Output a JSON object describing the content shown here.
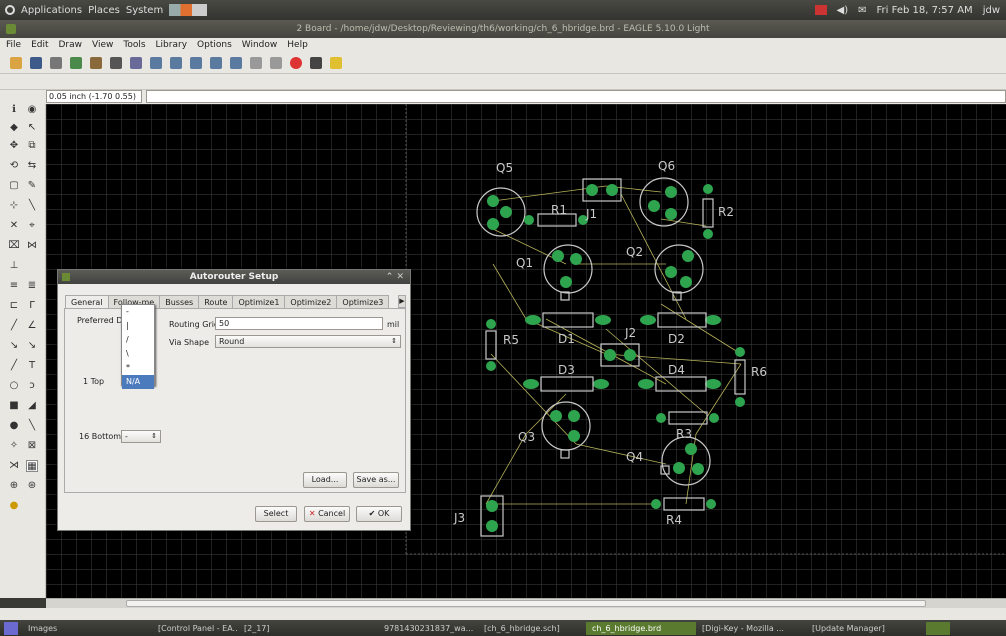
{
  "topbar": {
    "menus": [
      "Applications",
      "Places",
      "System"
    ],
    "datetime": "Fri Feb 18, 7:57 AM",
    "user": "jdw"
  },
  "window_title": "2 Board - /home/jdw/Desktop/Reviewing/th6/working/ch_6_hbridge.brd - EAGLE 5.10.0 Light",
  "menubar": [
    "File",
    "Edit",
    "Draw",
    "View",
    "Tools",
    "Library",
    "Options",
    "Window",
    "Help"
  ],
  "coord_readout": "0.05 inch (-1.70 0.55)",
  "canvas_labels": [
    "Q5",
    "Q6",
    "R1",
    "J1",
    "R2",
    "Q1",
    "Q2",
    "R5",
    "D1",
    "J2",
    "D2",
    "R6",
    "D3",
    "D4",
    "R3",
    "Q3",
    "Q4",
    "J3",
    "R4"
  ],
  "dialog": {
    "title": "Autorouter Setup",
    "tabs": [
      "General",
      "Follow-me",
      "Busses",
      "Route",
      "Optimize1",
      "Optimize2",
      "Optimize3"
    ],
    "preferred_label": "Preferred Dir",
    "layer_top": "1 Top",
    "layer_bottom": "16 Bottom",
    "bottom_value": "-",
    "routing_grid_label": "Routing Grid",
    "routing_grid_value": "50",
    "routing_grid_unit": "mil",
    "via_shape_label": "Via Shape",
    "via_shape_value": "Round",
    "load_button": "Load...",
    "saveas_button": "Save as...",
    "select_button": "Select",
    "cancel_button": "Cancel",
    "ok_button": "OK"
  },
  "dropdown": {
    "options": [
      "-",
      "|",
      "/",
      "\\",
      "*",
      "N/A"
    ],
    "selected": "N/A"
  },
  "taskbar": [
    "Images",
    "[Control Panel - EA...",
    "[2_17]",
    "9781430231837_wa...",
    "[ch_6_hbridge.sch]",
    "ch_6_hbridge.brd",
    "[Digi-Key - Mozilla ...",
    "[Update Manager]"
  ],
  "colors": {
    "canvas": "#000000",
    "pad": "#2ea44f",
    "outline": "#c9c9c9",
    "airwire": "#b8b45a",
    "accent": "#5a7a30"
  }
}
